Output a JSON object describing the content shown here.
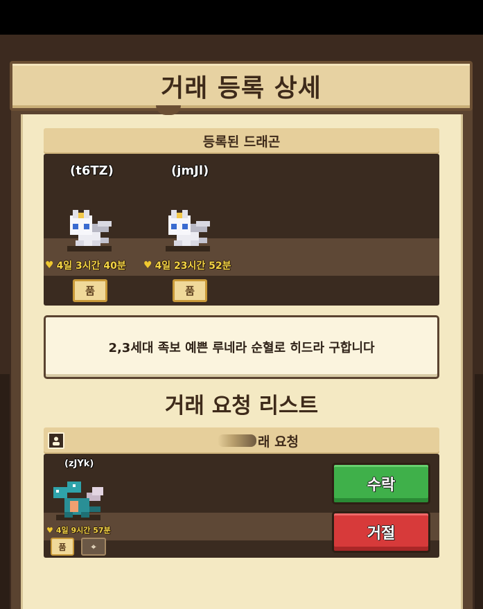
{
  "screen": {
    "title": "거래 등록 상세"
  },
  "registered": {
    "header": "등록된 드래곤",
    "dragons": [
      {
        "id_label": "(t6TZ)",
        "timer": "4일 3시간 40분",
        "species": "white-dragon"
      },
      {
        "id_label": "(jmJl)",
        "timer": "4일 23시간 52분",
        "species": "white-dragon"
      }
    ]
  },
  "note": {
    "text": "2,3세대 족보 예쁜 루네라 순혈로 히드라 구합니다"
  },
  "request_list": {
    "title": "거래 요청 리스트",
    "header": "래 요청",
    "requests": [
      {
        "id_label": "(zJYk)",
        "timer": "4일 9시간 57분",
        "species": "hydra",
        "accept_label": "수락",
        "reject_label": "거절"
      }
    ]
  },
  "icons": {
    "tree": "family-tree-icon",
    "heart": "heart-timer-icon",
    "profile": "profile-icon",
    "locate": "locate-icon"
  },
  "colors": {
    "accept": "#3fb04a",
    "reject": "#d73a3a",
    "panel": "#f4e9c3",
    "timer": "#f3d445"
  }
}
